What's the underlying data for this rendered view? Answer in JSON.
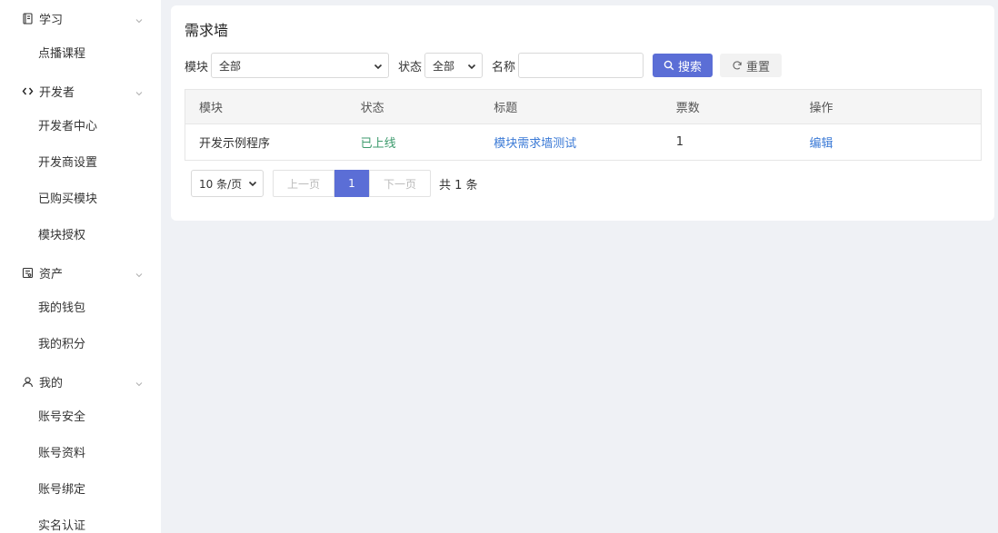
{
  "sidebar": {
    "groups": [
      {
        "icon": "book-icon",
        "label": "学习",
        "items": [
          "点播课程"
        ]
      },
      {
        "icon": "code-icon",
        "label": "开发者",
        "items": [
          "开发者中心",
          "开发商设置",
          "已购买模块",
          "模块授权"
        ]
      },
      {
        "icon": "asset-icon",
        "label": "资产",
        "items": [
          "我的钱包",
          "我的积分"
        ]
      },
      {
        "icon": "user-icon",
        "label": "我的",
        "items": [
          "账号安全",
          "账号资料",
          "账号绑定",
          "实名认证"
        ]
      }
    ]
  },
  "main": {
    "title": "需求墙",
    "filters": {
      "module_label": "模块",
      "module_value": "全部",
      "status_label": "状态",
      "status_value": "全部",
      "name_label": "名称",
      "name_value": "",
      "name_placeholder": "",
      "search_label": "搜索",
      "reset_label": "重置"
    },
    "table": {
      "headers": [
        "模块",
        "状态",
        "标题",
        "票数",
        "操作"
      ],
      "rows": [
        {
          "module": "开发示例程序",
          "status": "已上线",
          "title": "模块需求墙测试",
          "votes": "1",
          "action": "编辑"
        }
      ]
    },
    "pagination": {
      "page_size": "10 条/页",
      "prev": "上一页",
      "current": "1",
      "next": "下一页",
      "total": "共 1 条"
    }
  },
  "colors": {
    "accent": "#5b6ed6",
    "status_online": "#3c9a6c",
    "link": "#3b7ad6",
    "background": "#eff1f5"
  }
}
